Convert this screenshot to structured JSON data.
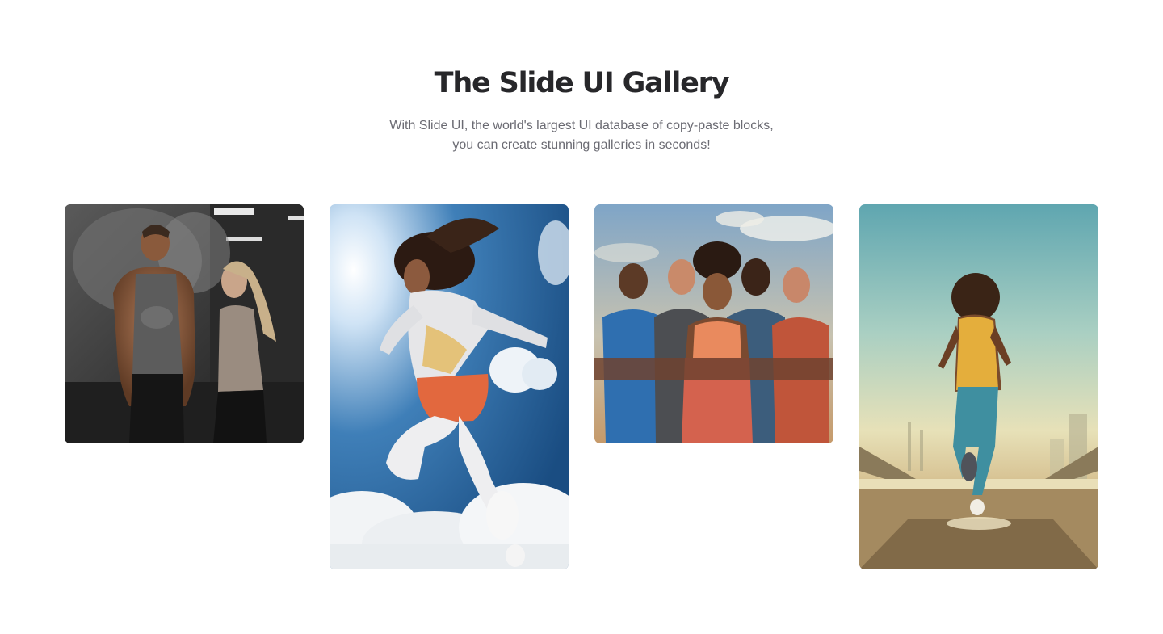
{
  "header": {
    "title": "The Slide UI Gallery",
    "subtitle_line1": "With Slide UI, the world's largest UI database of copy-paste blocks,",
    "subtitle_line2": "you can create stunning galleries in seconds!"
  },
  "gallery": {
    "images": [
      {
        "subject": "gym-couple-photo"
      },
      {
        "subject": "jumping-athlete-photo"
      },
      {
        "subject": "athlete-team-photo"
      },
      {
        "subject": "runner-bridge-photo"
      }
    ]
  },
  "colors": {
    "title": "#27272a",
    "subtitle": "#6b6b73",
    "background": "#ffffff"
  }
}
